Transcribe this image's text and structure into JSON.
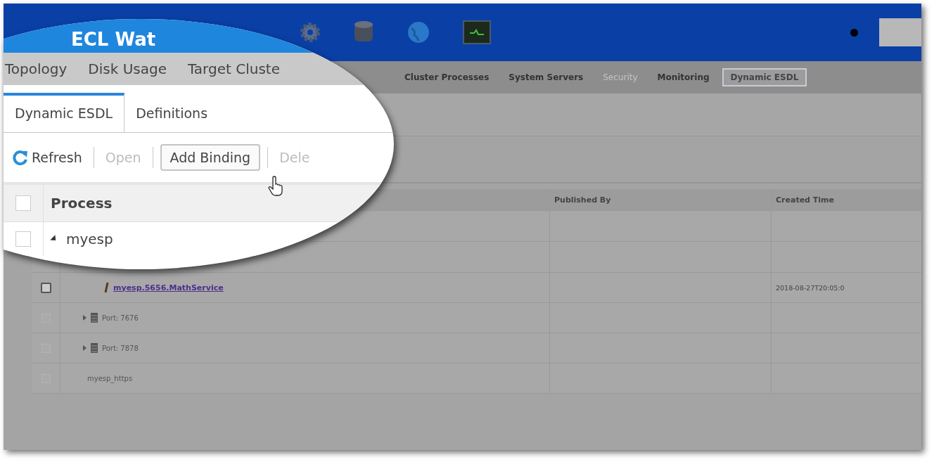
{
  "nav_tabs": [
    {
      "label": "Cluster Processes",
      "selected": false,
      "disabled": false
    },
    {
      "label": "System Servers",
      "selected": false,
      "disabled": false
    },
    {
      "label": "Security",
      "selected": false,
      "disabled": true
    },
    {
      "label": "Monitoring",
      "selected": false,
      "disabled": false
    },
    {
      "label": "Dynamic ESDL",
      "selected": true,
      "disabled": false
    }
  ],
  "table": {
    "columns": [
      "Published By",
      "Created Time"
    ],
    "rows": [
      {
        "kind": "service",
        "process": "myesp.5656.MathService",
        "created_time": "2018-08-27T20:05:0",
        "checked": false
      },
      {
        "kind": "port",
        "process": "Port: 7676",
        "expanded": false,
        "checked": false
      },
      {
        "kind": "port",
        "process": "Port: 7878",
        "expanded": false,
        "checked": false
      },
      {
        "kind": "binding",
        "process": "myesp_https",
        "checked": false
      }
    ]
  },
  "callout": {
    "title": "ECL Wat",
    "nav": [
      "Topology",
      "Disk Usage",
      "Target Cluste"
    ],
    "tabs": [
      {
        "label": "Dynamic ESDL",
        "selected": true
      },
      {
        "label": "Definitions",
        "selected": false
      }
    ],
    "toolbar": [
      {
        "kind": "refresh",
        "label": "Refresh",
        "disabled": false
      },
      {
        "kind": "plain",
        "label": "Open",
        "disabled": true
      },
      {
        "kind": "button",
        "label": "Add Binding",
        "disabled": false
      },
      {
        "kind": "plain",
        "label": "Dele",
        "disabled": true
      }
    ],
    "column": "Process",
    "select_all_checked": false,
    "rows": [
      {
        "label": "myesp",
        "expanded": true,
        "checked": false
      }
    ]
  }
}
